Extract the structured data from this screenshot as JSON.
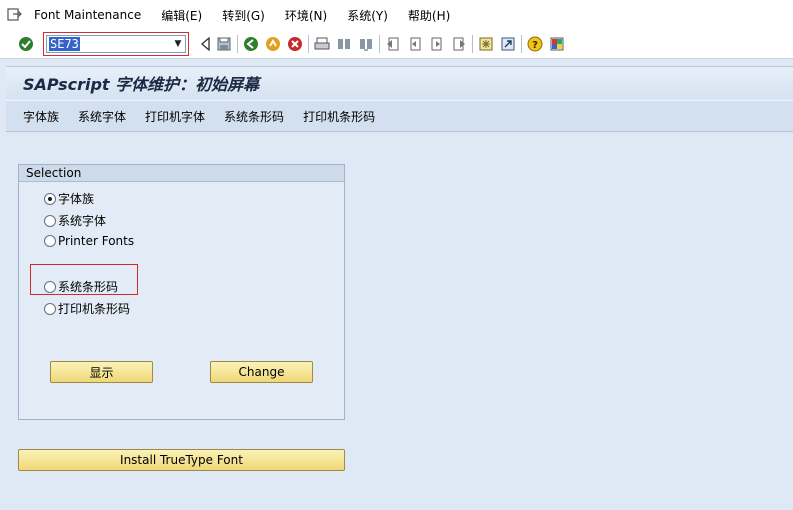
{
  "menubar": {
    "icon": "menu-exit-icon",
    "items": [
      "Font Maintenance",
      "编辑(E)",
      "转到(G)",
      "环境(N)",
      "系统(Y)",
      "帮助(H)"
    ]
  },
  "toolbar": {
    "command_value": "SE73"
  },
  "title": "SAPscript 字体维护：初始屏幕",
  "app_toolbar": [
    "字体族",
    "系统字体",
    "打印机字体",
    "系统条形码",
    "打印机条形码"
  ],
  "selection": {
    "heading": "Selection",
    "options": [
      "字体族",
      "系统字体",
      "Printer Fonts",
      "系统条形码",
      "打印机条形码"
    ],
    "selected": "字体族"
  },
  "buttons": {
    "display": "显示",
    "change": "Change",
    "install": "Install TrueType Font"
  },
  "colors": {
    "accent": "#3563c9",
    "button": "#f0d877",
    "highlight": "#d12a2a"
  }
}
